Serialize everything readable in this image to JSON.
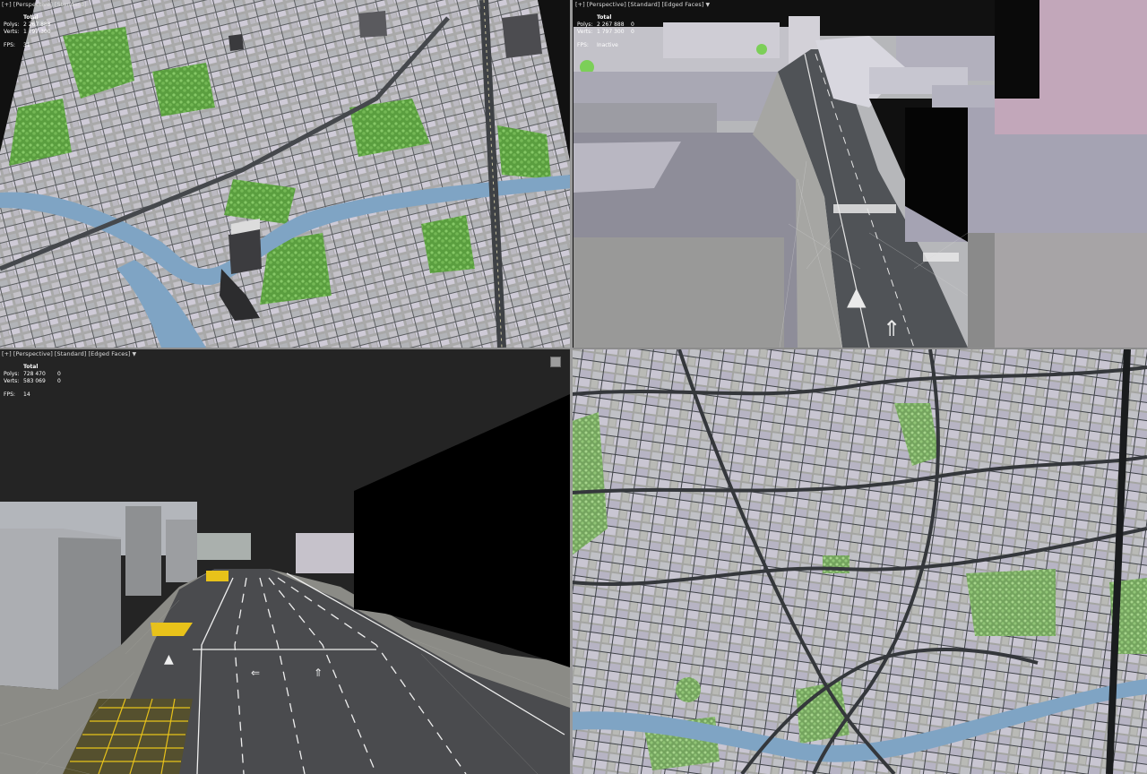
{
  "viewports": [
    {
      "id": "top-left",
      "label": {
        "plus": "[+]",
        "view": "[Perspective]",
        "shading": "[Standard]",
        "mode": ""
      },
      "stats": {
        "title": "Total",
        "polys_label": "Polys:",
        "polys": "2 267 888",
        "verts_label": "Verts:",
        "verts": "1 797 300",
        "fps_label": "FPS:",
        "fps": "31"
      }
    },
    {
      "id": "top-right",
      "label": {
        "plus": "[+]",
        "view": "[Perspective]",
        "shading": "[Standard]",
        "mode": "[Edged Faces]"
      },
      "stats": {
        "title": "Total",
        "polys_label": "Polys:",
        "polys": "2 267 888",
        "polys_sel": "0",
        "verts_label": "Verts:",
        "verts": "1 797 300",
        "verts_sel": "0",
        "fps_label": "FPS:",
        "fps": "Inactive"
      }
    },
    {
      "id": "bottom-left",
      "label": {
        "plus": "[+]",
        "view": "[Perspective]",
        "shading": "[Standard]",
        "mode": "[Edged Faces]"
      },
      "stats": {
        "title": "Total",
        "polys_label": "Polys:",
        "polys": "728 470",
        "polys_sel": "0",
        "verts_label": "Verts:",
        "verts": "583 069",
        "verts_sel": "0",
        "fps_label": "FPS:",
        "fps": "14"
      }
    },
    {
      "id": "bottom-right",
      "label": {
        "plus": "",
        "view": "",
        "shading": "",
        "mode": ""
      }
    }
  ],
  "colors": {
    "background": "#111111",
    "building": "#b9b8bd",
    "building_light": "#c9c5d2",
    "road": "#4a4d52",
    "road_dark": "#2f3236",
    "grass": "#5fa847",
    "trees": "#8fcb6f",
    "water": "#7fa4c4",
    "ground": "#8e8e8a",
    "lane_yellow": "#e8c21a",
    "facade_dark": "#050505",
    "sky_dark": "#232323"
  },
  "icons": {
    "filter": "funnel-icon",
    "viewport_toggle": "maximize-viewport-icon"
  }
}
